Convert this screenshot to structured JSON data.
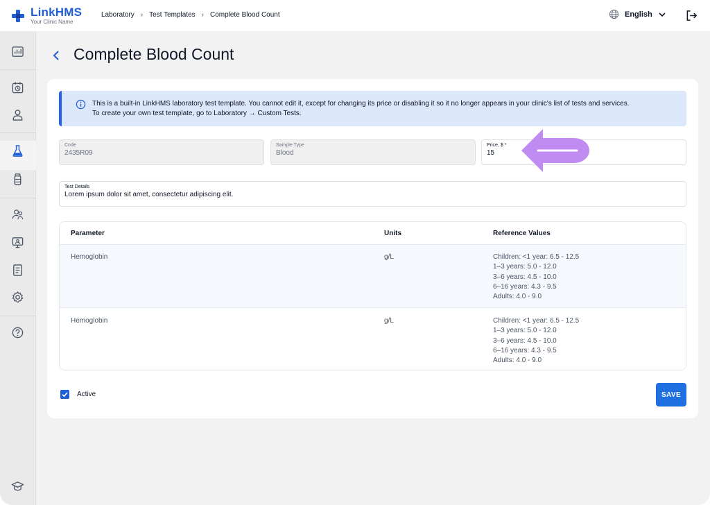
{
  "header": {
    "app_name": "LinkHMS",
    "app_subtitle": "Your Clinic Name",
    "breadcrumb": [
      "Laboratory",
      "Test Templates",
      "Complete Blood Count"
    ],
    "language": "English"
  },
  "sidebar": {
    "icons": [
      "dashboard-icon",
      "calendar-icon",
      "patient-icon",
      "laboratory-icon",
      "medication-icon",
      "staff-icon",
      "monitor-icon",
      "report-icon",
      "settings-icon",
      "help-icon",
      "academy-icon"
    ],
    "active": "laboratory-icon"
  },
  "page": {
    "title": "Complete Blood Count"
  },
  "info": {
    "line1": "This is a built-in LinkHMS laboratory test template. You cannot edit it, except for changing its price or disabling it so it no longer appears in your clinic's list of tests and services.",
    "line2": "To create your own test template, go to Laboratory → Custom Tests."
  },
  "fields": {
    "code_label": "Code",
    "code_value": "2435R09",
    "sample_label": "Sample Type",
    "sample_value": "Blood",
    "price_label": "Price, $ *",
    "price_value": "15",
    "details_label": "Test Details",
    "details_value": "Lorem ipsum dolor sit amet, consectetur adipiscing elit."
  },
  "table": {
    "headers": [
      "Parameter",
      "Units",
      "Reference Values"
    ],
    "rows": [
      {
        "parameter": "Hemoglobin",
        "units": "g/L",
        "reference": [
          "Children: <1 year: 6.5 - 12.5",
          "1–3 years: 5.0 - 12.0",
          "3–6 years: 4.5 - 10.0",
          "6–16 years: 4.3 - 9.5",
          "Adults: 4.0 - 9.0"
        ]
      },
      {
        "parameter": "Hemoglobin",
        "units": "g/L",
        "reference": [
          "Children: <1 year: 6.5 - 12.5",
          "1–3 years: 5.0 - 12.0",
          "3–6 years: 4.5 - 10.0",
          "6–16 years: 4.3 - 9.5",
          "Adults: 4.0 - 9.0"
        ]
      }
    ]
  },
  "footer": {
    "active_label": "Active",
    "active_checked": true,
    "save_label": "SAVE"
  },
  "colors": {
    "brand": "#1f5fd6",
    "info_bg": "#dde7fa",
    "hint_arrow": "#c08cf2"
  }
}
